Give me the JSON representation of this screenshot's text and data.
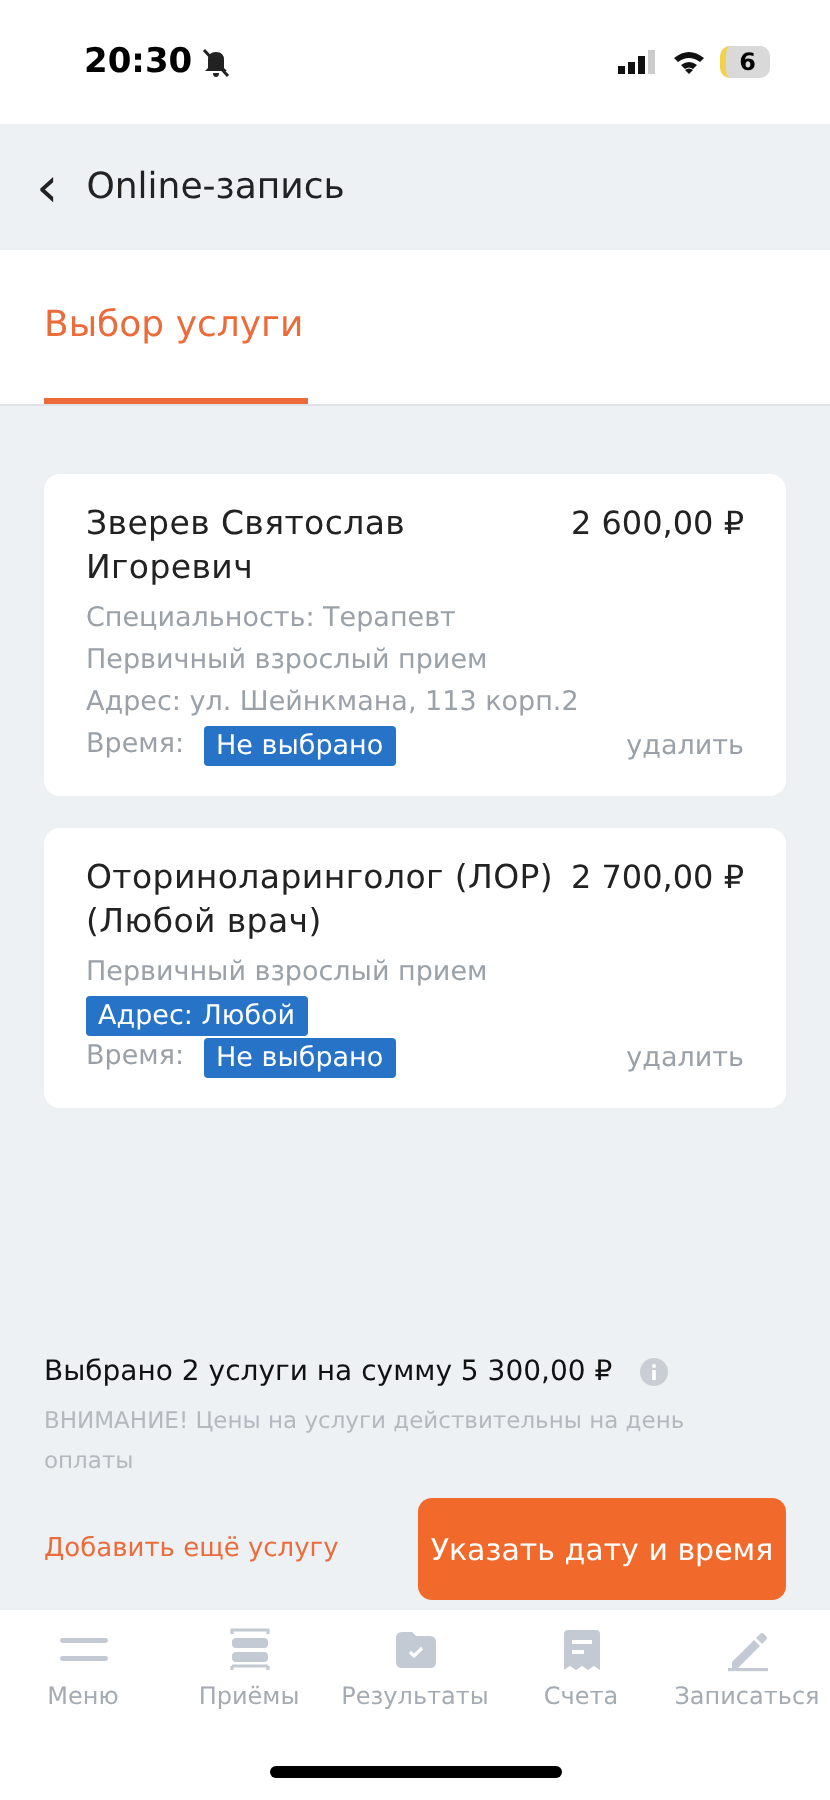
{
  "status_bar": {
    "time": "20:30",
    "battery": "6"
  },
  "header": {
    "back": "‹",
    "title": "Online-запись"
  },
  "tabs": [
    {
      "label": "Выбор услуги",
      "selected": true
    }
  ],
  "cards": [
    {
      "title": "Зверев Святослав Игоревич",
      "price": "2 600,00 ₽",
      "lines": [
        {
          "kind": "text",
          "text": "Специальность: Терапевт"
        },
        {
          "kind": "text",
          "text": "Первичный взрослый прием"
        },
        {
          "kind": "text",
          "text": "Адрес: ул. Шейнкмана, 113 корп.2"
        }
      ],
      "time_label": "Время:",
      "time_value": "Не выбрано",
      "delete": "удалить"
    },
    {
      "title": "Оториноларинголог (ЛОР) (Любой врач)",
      "price": "2 700,00 ₽",
      "lines": [
        {
          "kind": "text",
          "text": "Первичный взрослый прием"
        },
        {
          "kind": "tag",
          "text": "Адрес: Любой"
        }
      ],
      "time_label": "Время:",
      "time_value": "Не выбрано",
      "delete": "удалить"
    }
  ],
  "summary": {
    "text": "Выбрано 2 услуги на сумму 5 300,00 ₽",
    "notice": "ВНИМАНИЕ! Цены на услуги действительны на день оплаты",
    "add_link": "Добавить ещё услугу",
    "button": "Указать дату и время"
  },
  "tab_bar": [
    {
      "label": "Меню",
      "kind": "menu"
    },
    {
      "label": "Приёмы",
      "kind": "visits"
    },
    {
      "label": "Результаты",
      "kind": "results"
    },
    {
      "label": "Счета",
      "kind": "bills"
    },
    {
      "label": "Записаться",
      "kind": "booking"
    }
  ]
}
